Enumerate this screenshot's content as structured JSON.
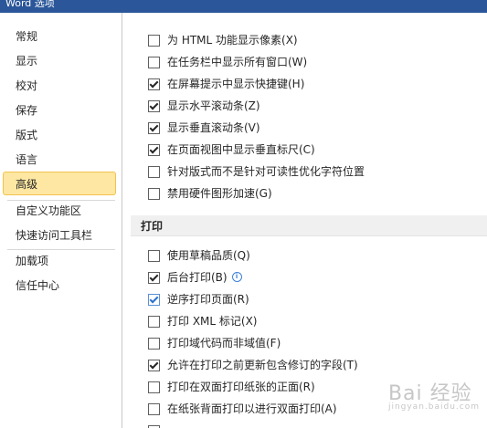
{
  "window": {
    "title": "Word 选项"
  },
  "sidebar": {
    "items": [
      {
        "label": "常规"
      },
      {
        "label": "显示"
      },
      {
        "label": "校对"
      },
      {
        "label": "保存"
      },
      {
        "label": "版式"
      },
      {
        "label": "语言"
      },
      {
        "label": "高级",
        "selected": true
      },
      {
        "label": "自定义功能区"
      },
      {
        "label": "快速访问工具栏"
      },
      {
        "label": "加载项"
      },
      {
        "label": "信任中心"
      }
    ]
  },
  "display_options": [
    {
      "label": "为 HTML 功能显示像素(X)",
      "checked": false
    },
    {
      "label": "在任务栏中显示所有窗口(W)",
      "checked": false
    },
    {
      "label": "在屏幕提示中显示快捷键(H)",
      "checked": true
    },
    {
      "label": "显示水平滚动条(Z)",
      "checked": true
    },
    {
      "label": "显示垂直滚动条(V)",
      "checked": true
    },
    {
      "label": "在页面视图中显示垂直标尺(C)",
      "checked": true
    },
    {
      "label": "针对版式而不是针对可读性优化字符位置",
      "checked": false
    },
    {
      "label": "禁用硬件图形加速(G)",
      "checked": false
    }
  ],
  "print_section": {
    "title": "打印",
    "options": [
      {
        "label": "使用草稿品质(Q)",
        "checked": false
      },
      {
        "label": "后台打印(B)",
        "checked": true,
        "info_icon": "info-icon"
      },
      {
        "label": "逆序打印页面(R)",
        "checked": true,
        "focused": true
      },
      {
        "label": "打印 XML 标记(X)",
        "checked": false
      },
      {
        "label": "打印域代码而非域值(F)",
        "checked": false
      },
      {
        "label": "允许在打印之前更新包含修订的字段(T)",
        "checked": true
      },
      {
        "label": "打印在双面打印纸张的正面(R)",
        "checked": false
      },
      {
        "label": "在纸张背面打印以进行双面打印(A)",
        "checked": false
      }
    ]
  },
  "watermark": {
    "text": "Bai 经验",
    "subtext": "jingyan.baidu.com"
  },
  "colors": {
    "title_bar": "#2b579a",
    "selected_nav_bg": "#fde7a2",
    "selected_nav_border": "#f2c34e",
    "section_header_bg": "#f0f0f0"
  }
}
